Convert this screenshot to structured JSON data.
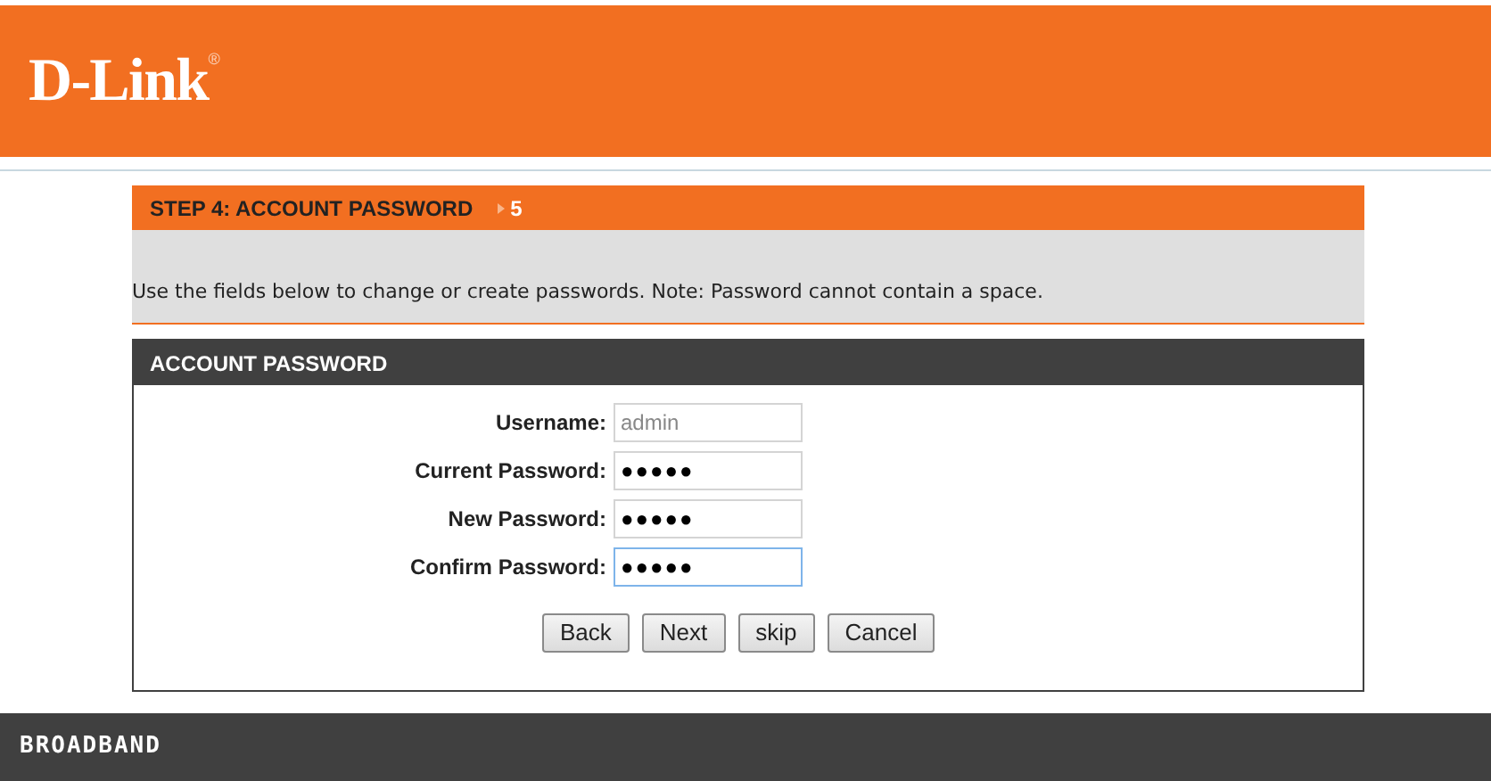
{
  "header": {
    "logo": "D-Link",
    "logo_mark": "®"
  },
  "step": {
    "title": "STEP 4: ACCOUNT PASSWORD",
    "next_step": "5"
  },
  "instructions": "Use the fields below to change or create passwords. Note: Password cannot contain a space.",
  "panel": {
    "title": "ACCOUNT PASSWORD",
    "fields": [
      {
        "label": "Username:",
        "value": "admin",
        "disabled": true,
        "focused": false
      },
      {
        "label": "Current Password:",
        "value": "●●●●●",
        "disabled": false,
        "focused": false
      },
      {
        "label": "New Password:",
        "value": "●●●●●",
        "disabled": false,
        "focused": false
      },
      {
        "label": "Confirm Password:",
        "value": "●●●●●",
        "disabled": false,
        "focused": true
      }
    ],
    "buttons": [
      "Back",
      "Next",
      "skip",
      "Cancel"
    ]
  },
  "footer": {
    "text": "BROADBAND"
  }
}
